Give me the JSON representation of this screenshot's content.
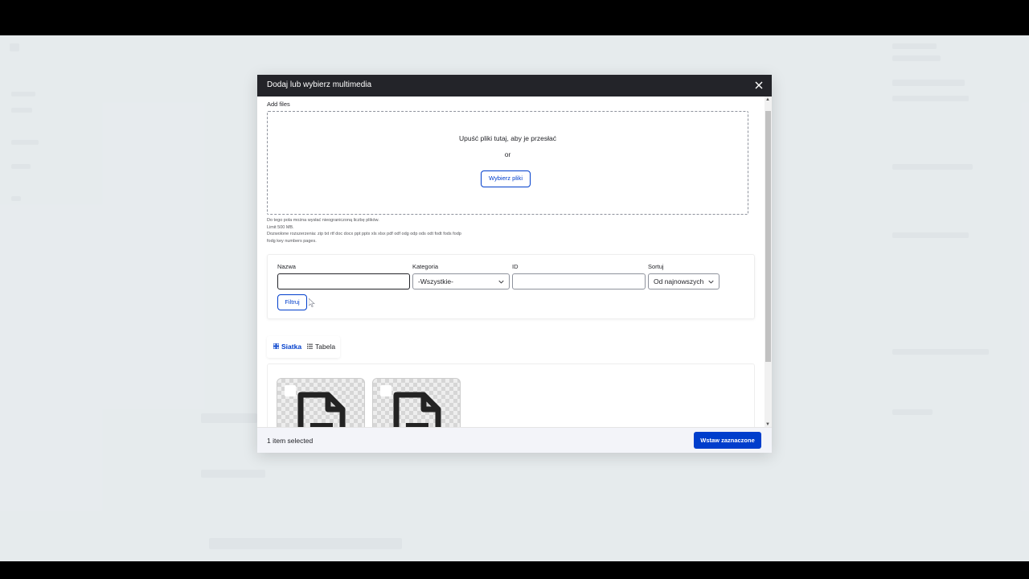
{
  "dialog": {
    "title": "Dodaj lub wybierz multimedia",
    "close_icon": "close-icon"
  },
  "upload": {
    "label": "Add files",
    "drop_text": "Upuść pliki tutaj, aby je przesłać",
    "or_text": "or",
    "choose_button": "Wybierz pliki",
    "help_lines": [
      "Do tego pola można wysłać nieograniczoną liczbę plików.",
      "Limit 500 MB.",
      "Dozwolone rozszerzenia: zip txt rtf doc docx ppt pptx xls xlsx pdf odf odg odp ods odt fodt fods fodp",
      "fodg key numbers pages."
    ]
  },
  "filters": {
    "name_label": "Nazwa",
    "name_value": "",
    "category_label": "Kategoria",
    "category_value": "-Wszystkie-",
    "id_label": "ID",
    "id_value": "",
    "sort_label": "Sortuj",
    "sort_value": "Od najnowszych",
    "filter_button": "Filtruj"
  },
  "views": {
    "grid_label": "Siatka",
    "table_label": "Tabela",
    "active": "grid"
  },
  "items": [
    {
      "type": "document",
      "selected": false
    },
    {
      "type": "document",
      "selected": false
    }
  ],
  "footer": {
    "status": "1 item selected",
    "insert_button": "Wstaw zaznaczone"
  },
  "colors": {
    "accent": "#003ecc",
    "titlebar": "#232429"
  }
}
